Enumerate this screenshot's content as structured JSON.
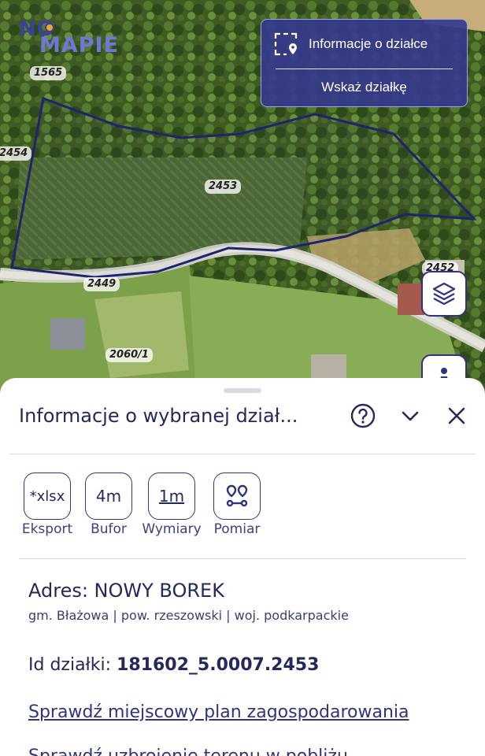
{
  "map": {
    "logo": {
      "part1": "NO",
      "part2": "MAPIE"
    },
    "parcel_labels": [
      "1565",
      "2454",
      "2453",
      "2449",
      "2060/1",
      "2452"
    ],
    "info_panel": {
      "title": "Informacje o działce",
      "action": "Wskaż działkę"
    },
    "colors": {
      "panel_bg": "#35398c",
      "boundary": "#20236e"
    },
    "icons": {
      "info_panel": "parcel-select-icon",
      "layers": "layers-icon",
      "location": "person-icon"
    }
  },
  "sheet": {
    "title": "Informacje o wybranej dział...",
    "icons": {
      "help": "help-circle-icon",
      "collapse": "chevron-down-icon",
      "close": "close-icon"
    },
    "tools": [
      {
        "label": "*xlsx",
        "caption": "Eksport",
        "icon": "export-icon"
      },
      {
        "label": "4m",
        "caption": "Bufor",
        "icon": "buffer-icon"
      },
      {
        "label": "1m",
        "caption": "Wymiary",
        "icon": "dimensions-icon"
      },
      {
        "label": "",
        "caption": "Pomiar",
        "icon": "measure-pins-icon"
      }
    ],
    "address_label": "Adres: NOWY BOREK",
    "address_sub": "gm. Błażowa | pow. rzeszowski | woj. podkarpackie",
    "id_label": "Id działki:",
    "id_value": "181602_5.0007.2453",
    "links": [
      "Sprawdź miejscowy plan zagospodarowania",
      "Sprawdź uzbrojenie terenu w pobliżu"
    ],
    "accent": "#2f3380"
  }
}
